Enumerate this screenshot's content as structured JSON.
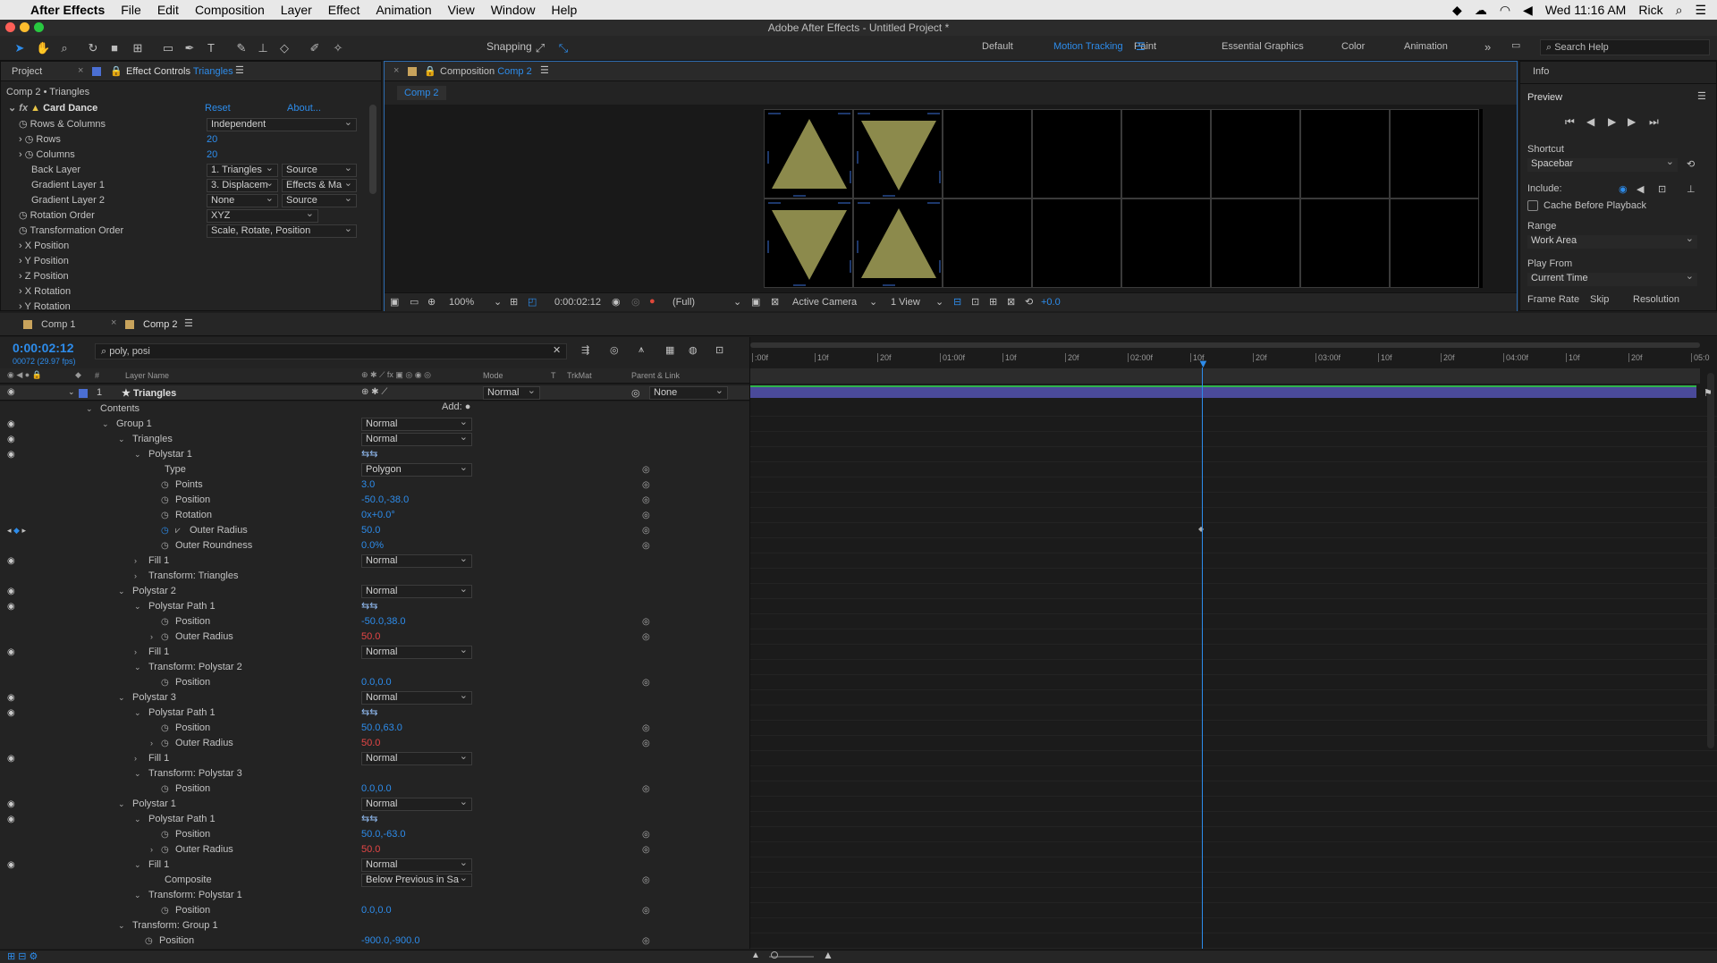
{
  "menubar": {
    "app": "After Effects",
    "items": [
      "File",
      "Edit",
      "Composition",
      "Layer",
      "Effect",
      "Animation",
      "View",
      "Window",
      "Help"
    ],
    "clock": "Wed 11:16 AM",
    "user": "Rick"
  },
  "window_title": "Adobe After Effects - Untitled Project *",
  "toolbar": {
    "snapping": "Snapping",
    "workspaces": [
      "Default",
      "Motion Tracking",
      "Paint",
      "Essential Graphics",
      "Color",
      "Animation"
    ],
    "active_workspace": "Motion Tracking",
    "search_placeholder": "Search Help"
  },
  "effect_panel": {
    "tab_project": "Project",
    "tab_effect": "Effect Controls",
    "tab_layer": "Triangles",
    "header": "Comp 2 • Triangles",
    "effect_name": "Card Dance",
    "reset": "Reset",
    "about": "About...",
    "rows": [
      {
        "label": "Rows & Columns",
        "dd": "Independent"
      },
      {
        "label": "Rows",
        "val": "20"
      },
      {
        "label": "Columns",
        "val": "20"
      },
      {
        "label": "Back Layer",
        "dd": "1. Triangles",
        "dd2": "Source"
      },
      {
        "label": "Gradient Layer 1",
        "dd": "3. Displacem",
        "dd2": "Effects & Ma"
      },
      {
        "label": "Gradient Layer 2",
        "dd": "None",
        "dd2": "Source"
      },
      {
        "label": "Rotation Order",
        "dd": "XYZ"
      },
      {
        "label": "Transformation Order",
        "dd": "Scale, Rotate, Position"
      },
      {
        "label": "X Position"
      },
      {
        "label": "Y Position"
      },
      {
        "label": "Z Position"
      },
      {
        "label": "X Rotation"
      },
      {
        "label": "Y Rotation"
      }
    ]
  },
  "comp_panel": {
    "tab": "Composition",
    "comp_name": "Comp 2",
    "subtab": "Comp 2",
    "zoom": "100%",
    "timecode": "0:00:02:12",
    "resolution": "(Full)",
    "camera": "Active Camera",
    "view": "1 View",
    "exposure": "+0.0"
  },
  "preview": {
    "info": "Info",
    "title": "Preview",
    "shortcut_label": "Shortcut",
    "shortcut": "Spacebar",
    "include": "Include:",
    "cache": "Cache Before Playback",
    "range_label": "Range",
    "range": "Work Area",
    "play_from_label": "Play From",
    "play_from": "Current Time",
    "footer": [
      "Frame Rate",
      "Skip",
      "Resolution"
    ]
  },
  "timeline": {
    "tabs": [
      "Comp 1",
      "Comp 2"
    ],
    "timecode": "0:00:02:12",
    "frames": "00072 (29.97 fps)",
    "search": "poly, posi",
    "headers": {
      "layer_name": "Layer Name",
      "mode": "Mode",
      "t": "T",
      "trkmat": "TrkMat",
      "parent": "Parent & Link"
    },
    "ruler": [
      ":00f",
      "10f",
      "20f",
      "01:00f",
      "10f",
      "20f",
      "02:00f",
      "10f",
      "20f",
      "03:00f",
      "10f",
      "20f",
      "04:00f",
      "10f",
      "20f",
      "05:0"
    ],
    "layer": {
      "num": "1",
      "name": "Triangles",
      "mode": "Normal",
      "parent": "None"
    },
    "add_label": "Add:",
    "lines": [
      {
        "d": 0,
        "name": "Contents",
        "eye": false,
        "tw": "v"
      },
      {
        "d": 1,
        "name": "Group 1",
        "eye": true,
        "tw": "v",
        "mode": "Normal"
      },
      {
        "d": 2,
        "name": "Triangles",
        "eye": true,
        "tw": "v",
        "mode": "Normal"
      },
      {
        "d": 3,
        "name": "Polystar 1",
        "eye": true,
        "tw": "v",
        "icon": "path"
      },
      {
        "d": 4,
        "name": "Type",
        "mode": "Polygon",
        "pk": true
      },
      {
        "d": 4,
        "name": "Points",
        "watch": true,
        "val": "3.0",
        "pk": true
      },
      {
        "d": 4,
        "name": "Position",
        "watch": true,
        "val": "-50.0,-38.0",
        "pk": true
      },
      {
        "d": 4,
        "name": "Rotation",
        "watch": true,
        "val": "0x+0.0°",
        "pk": true
      },
      {
        "d": 4,
        "name": "Outer Radius",
        "watch": true,
        "val": "50.0",
        "pk": true,
        "key": true
      },
      {
        "d": 4,
        "name": "Outer Roundness",
        "watch": true,
        "val": "0.0%",
        "pk": true
      },
      {
        "d": 3,
        "name": "Fill 1",
        "eye": true,
        "tw": ">",
        "mode": "Normal"
      },
      {
        "d": 3,
        "name": "Transform: Triangles",
        "tw": ">"
      },
      {
        "d": 2,
        "name": "Polystar 2",
        "eye": true,
        "tw": "v",
        "mode": "Normal"
      },
      {
        "d": 3,
        "name": "Polystar Path 1",
        "eye": true,
        "tw": "v",
        "icon": "path"
      },
      {
        "d": 4,
        "name": "Position",
        "watch": true,
        "val": "-50.0,38.0",
        "pk": true
      },
      {
        "d": 4,
        "name": "Outer Radius",
        "watch": true,
        "tw": ">",
        "val": "50.0",
        "red": true,
        "pk": true
      },
      {
        "d": 3,
        "name": "Fill 1",
        "eye": true,
        "tw": ">",
        "mode": "Normal"
      },
      {
        "d": 3,
        "name": "Transform: Polystar 2",
        "tw": "v"
      },
      {
        "d": 4,
        "name": "Position",
        "watch": true,
        "val": "0.0,0.0",
        "pk": true
      },
      {
        "d": 2,
        "name": "Polystar 3",
        "eye": true,
        "tw": "v",
        "mode": "Normal"
      },
      {
        "d": 3,
        "name": "Polystar Path 1",
        "eye": true,
        "tw": "v",
        "icon": "path"
      },
      {
        "d": 4,
        "name": "Position",
        "watch": true,
        "val": "50.0,63.0",
        "pk": true
      },
      {
        "d": 4,
        "name": "Outer Radius",
        "watch": true,
        "tw": ">",
        "val": "50.0",
        "red": true,
        "pk": true
      },
      {
        "d": 3,
        "name": "Fill 1",
        "eye": true,
        "tw": ">",
        "mode": "Normal"
      },
      {
        "d": 3,
        "name": "Transform: Polystar 3",
        "tw": "v"
      },
      {
        "d": 4,
        "name": "Position",
        "watch": true,
        "val": "0.0,0.0",
        "pk": true
      },
      {
        "d": 2,
        "name": "Polystar 1",
        "eye": true,
        "tw": "v",
        "mode": "Normal"
      },
      {
        "d": 3,
        "name": "Polystar Path 1",
        "eye": true,
        "tw": "v",
        "icon": "path"
      },
      {
        "d": 4,
        "name": "Position",
        "watch": true,
        "val": "50.0,-63.0",
        "pk": true
      },
      {
        "d": 4,
        "name": "Outer Radius",
        "watch": true,
        "tw": ">",
        "val": "50.0",
        "red": true,
        "pk": true
      },
      {
        "d": 3,
        "name": "Fill 1",
        "eye": true,
        "tw": "v",
        "mode": "Normal"
      },
      {
        "d": 4,
        "name": "Composite",
        "mode": "Below Previous in Sa",
        "pk": true
      },
      {
        "d": 3,
        "name": "Transform: Polystar 1",
        "tw": "v"
      },
      {
        "d": 4,
        "name": "Position",
        "watch": true,
        "val": "0.0,0.0",
        "pk": true
      },
      {
        "d": 2,
        "name": "Transform: Group 1",
        "tw": "v"
      },
      {
        "d": 3,
        "name": "Position",
        "watch": true,
        "val": "-900.0,-900.0",
        "pk": true
      }
    ]
  },
  "colors": {
    "accent": "#2d8ceb",
    "triangle": "#8c8a4c",
    "layer_bar": "#4a4a9a"
  }
}
